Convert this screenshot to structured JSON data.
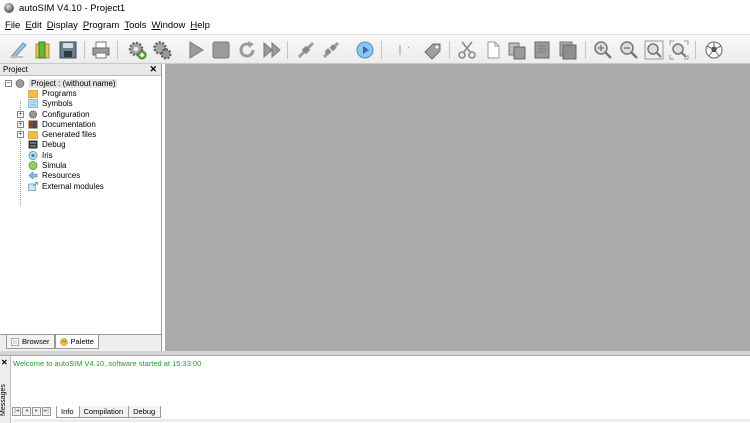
{
  "window": {
    "title": "autoSIM  V4.10 - Project1"
  },
  "menu": [
    {
      "mn": "F",
      "rest": "ile"
    },
    {
      "mn": "E",
      "rest": "dit"
    },
    {
      "mn": "D",
      "rest": "isplay"
    },
    {
      "mn": "P",
      "rest": "rogram"
    },
    {
      "mn": "T",
      "rest": "ools"
    },
    {
      "mn": "W",
      "rest": "indow"
    },
    {
      "mn": "H",
      "rest": "elp"
    }
  ],
  "toolbar_icons": [
    "new-project-icon",
    "open-project-icon",
    "save-icon",
    "print-icon",
    "compile-gear-icon",
    "settings-gear-icon",
    "run-icon",
    "stop-icon",
    "restart-icon",
    "fast-forward-icon",
    "connect-icon",
    "disconnect-icon",
    "step-icon",
    "cursor-icon",
    "tag-icon",
    "cut-icon",
    "copy-icon",
    "paste-icon",
    "duplicate-icon",
    "delete-icon",
    "zoom-in-icon",
    "zoom-out-icon",
    "zoom-fit-icon",
    "zoom-reset-icon",
    "ball-icon"
  ],
  "left_panel": {
    "title": "Project",
    "tree": {
      "root": "Project : (without name)",
      "items": [
        {
          "label": "Programs",
          "icon": "programs-folder-icon",
          "expandable": false
        },
        {
          "label": "Symbols",
          "icon": "symbols-icon",
          "expandable": false
        },
        {
          "label": "Configuration",
          "icon": "configuration-icon",
          "expandable": true
        },
        {
          "label": "Documentation",
          "icon": "documentation-icon",
          "expandable": true
        },
        {
          "label": "Generated files",
          "icon": "generated-files-icon",
          "expandable": true
        },
        {
          "label": "Debug",
          "icon": "debug-icon",
          "expandable": false
        },
        {
          "label": "Iris",
          "icon": "iris-icon",
          "expandable": false
        },
        {
          "label": "Simula",
          "icon": "simula-icon",
          "expandable": false
        },
        {
          "label": "Resources",
          "icon": "resources-icon",
          "expandable": false
        },
        {
          "label": "External modules",
          "icon": "external-modules-icon",
          "expandable": false
        }
      ]
    },
    "tabs": [
      {
        "label": "Browser",
        "active": false
      },
      {
        "label": "Palette",
        "active": true
      }
    ]
  },
  "messages": {
    "panel_label": "Messages",
    "lines": [
      "Welcome to autoSIM  V4.10..software started at 15:33:00"
    ],
    "tabs": [
      {
        "label": "Info",
        "active": true
      },
      {
        "label": "Compilation",
        "active": false
      },
      {
        "label": "Debug",
        "active": false
      }
    ]
  },
  "colors": {
    "mdi_background": "#ababab",
    "message_text": "#2a9a2a"
  }
}
